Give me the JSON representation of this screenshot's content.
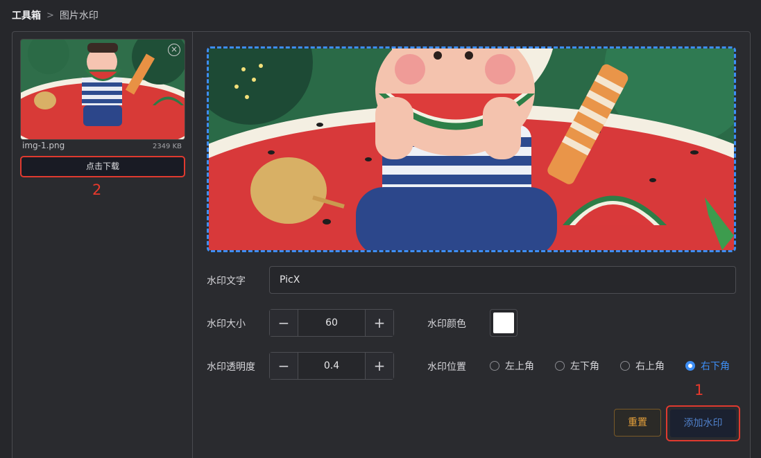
{
  "breadcrumb": {
    "root": "工具箱",
    "separator": ">",
    "current": "图片水印"
  },
  "file": {
    "name": "img-1.png",
    "size": "2349 KB",
    "download_label": "点击下载",
    "close_icon": "×"
  },
  "annotations": {
    "one": "1",
    "two": "2"
  },
  "form": {
    "text_label": "水印文字",
    "text_value": "PicX",
    "size_label": "水印大小",
    "size_value": "60",
    "opacity_label": "水印透明度",
    "opacity_value": "0.4",
    "color_label": "水印颜色",
    "color_value": "#ffffff",
    "position_label": "水印位置",
    "positions": [
      "左上角",
      "左下角",
      "右上角",
      "右下角"
    ],
    "selected_position": "右下角",
    "minus": "−",
    "plus": "+"
  },
  "buttons": {
    "reset": "重置",
    "add": "添加水印"
  },
  "colors": {
    "accent": "#3d8ef5",
    "highlight": "#e03a2f",
    "reset": "#e5a03a"
  }
}
